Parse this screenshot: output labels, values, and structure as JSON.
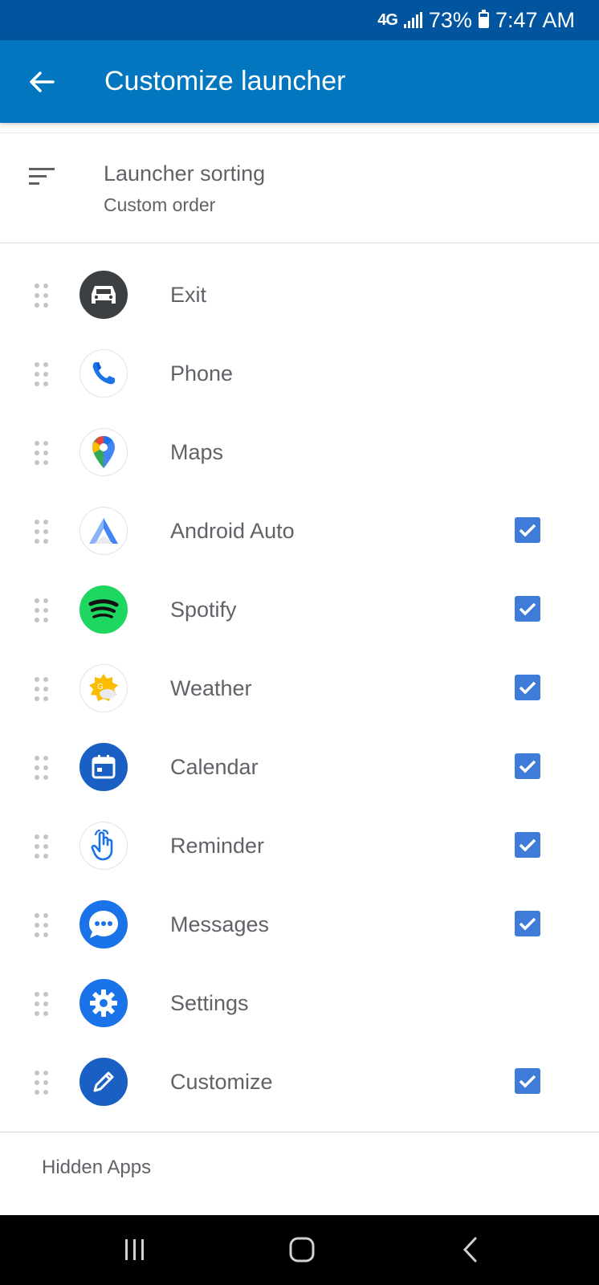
{
  "status_bar": {
    "network": "4G",
    "battery": "73%",
    "time": "7:47 AM"
  },
  "app_bar": {
    "title": "Customize launcher",
    "back_icon": "arrow-left-icon"
  },
  "sorting": {
    "title": "Launcher sorting",
    "value": "Custom order",
    "icon": "sort-icon"
  },
  "apps": [
    {
      "label": "Exit",
      "icon": "car-icon",
      "checked": false
    },
    {
      "label": "Phone",
      "icon": "phone-icon",
      "checked": false
    },
    {
      "label": "Maps",
      "icon": "maps-pin-icon",
      "checked": false
    },
    {
      "label": "Android Auto",
      "icon": "android-auto-icon",
      "checked": true
    },
    {
      "label": "Spotify",
      "icon": "spotify-icon",
      "checked": true
    },
    {
      "label": "Weather",
      "icon": "weather-icon",
      "checked": true
    },
    {
      "label": "Calendar",
      "icon": "calendar-icon",
      "checked": true
    },
    {
      "label": "Reminder",
      "icon": "reminder-hand-icon",
      "checked": true
    },
    {
      "label": "Messages",
      "icon": "messages-icon",
      "checked": true
    },
    {
      "label": "Settings",
      "icon": "gear-icon",
      "checked": false
    },
    {
      "label": "Customize",
      "icon": "pencil-icon",
      "checked": true
    }
  ],
  "hidden_apps": {
    "label": "Hidden Apps"
  },
  "nav_bar": {
    "recents_icon": "recents-icon",
    "home_icon": "home-icon",
    "back_icon": "back-chevron-icon"
  },
  "colors": {
    "status_bar": "#00559e",
    "app_bar": "#0277c0",
    "checkbox": "#3f7cd9",
    "text": "#5f6368"
  }
}
